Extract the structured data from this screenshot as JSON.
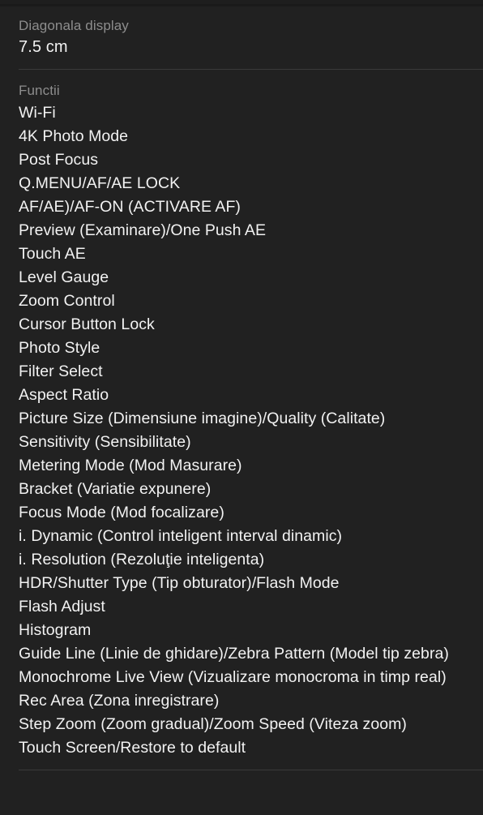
{
  "panel": {
    "background_color": "#212121",
    "divider_color": "#3a3a3a",
    "label_color": "#8d8d8d",
    "value_color": "#f2f2f2"
  },
  "spec": {
    "label": "Diagonala display",
    "value": "7.5 cm"
  },
  "features": {
    "label": "Functii",
    "items": [
      "Wi-Fi",
      "4K Photo Mode",
      "Post Focus",
      "Q.MENU/AF/AE LOCK",
      "AF/AE)/AF-ON (ACTIVARE AF)",
      "Preview (Examinare)/One Push AE",
      "Touch AE",
      "Level Gauge",
      "Zoom Control",
      "Cursor Button Lock",
      "Photo Style",
      "Filter Select",
      "Aspect Ratio",
      "Picture Size (Dimensiune imagine)/Quality (Calitate)",
      "Sensitivity (Sensibilitate)",
      "Metering Mode (Mod Masurare)",
      "Bracket (Variatie expunere)",
      "Focus Mode (Mod focalizare)",
      "i. Dynamic (Control inteligent interval dinamic)",
      "i. Resolution (Rezoluţie inteligenta)",
      "HDR/Shutter Type (Tip obturator)/Flash Mode",
      "Flash Adjust",
      "Histogram",
      "Guide Line (Linie de ghidare)/Zebra Pattern (Model tip zebra)",
      "Monochrome Live View (Vizualizare monocroma in timp real)",
      "Rec Area (Zona inregistrare)",
      "Step Zoom (Zoom gradual)/Zoom Speed (Viteza zoom)",
      "Touch Screen/Restore to default"
    ]
  }
}
